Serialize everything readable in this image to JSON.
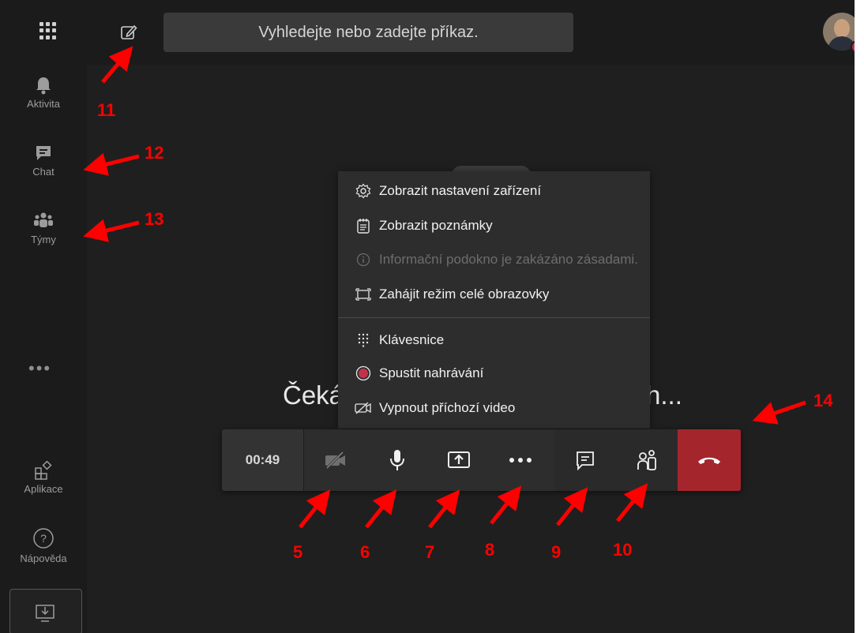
{
  "search": {
    "placeholder": "Vyhledejte nebo zadejte příkaz."
  },
  "rail": {
    "items": [
      {
        "label": "Aktivita",
        "icon": "bell-icon"
      },
      {
        "label": "Chat",
        "icon": "chat-icon"
      },
      {
        "label": "Týmy",
        "icon": "teams-icon"
      },
      {
        "label": "Aplikace",
        "icon": "apps-icon"
      },
      {
        "label": "Nápověda",
        "icon": "help-icon"
      }
    ],
    "more": "•••"
  },
  "stage": {
    "waiting_left": "Čeká",
    "waiting_right": "h..."
  },
  "menu": {
    "items": [
      {
        "label": "Zobrazit nastavení zařízení",
        "icon": "settings-icon"
      },
      {
        "label": "Zobrazit poznámky",
        "icon": "notes-icon"
      },
      {
        "label": "Informační podokno je zakázáno zásadami.",
        "icon": "info-icon",
        "disabled": true
      },
      {
        "label": "Zahájit režim celé obrazovky",
        "icon": "fullscreen-icon"
      },
      {
        "label": "Klávesnice",
        "icon": "keypad-icon"
      },
      {
        "label": "Spustit nahrávání",
        "icon": "record-icon"
      },
      {
        "label": "Vypnout příchozí video",
        "icon": "video-off-icon"
      }
    ]
  },
  "controls": {
    "timer": "00:49",
    "buttons": [
      "camera-off-icon",
      "microphone-icon",
      "share-screen-icon",
      "more-icon",
      "chat-icon",
      "participants-icon",
      "hangup-icon"
    ]
  },
  "annotations": {
    "labels": [
      "5",
      "6",
      "7",
      "8",
      "9",
      "10",
      "11",
      "12",
      "13",
      "14"
    ],
    "color": "#ff0000"
  },
  "theme": {
    "background": "#1f1f1f",
    "menu": "#2d2d2d",
    "hangup": "#a4262c",
    "presence": "#c4314b"
  }
}
